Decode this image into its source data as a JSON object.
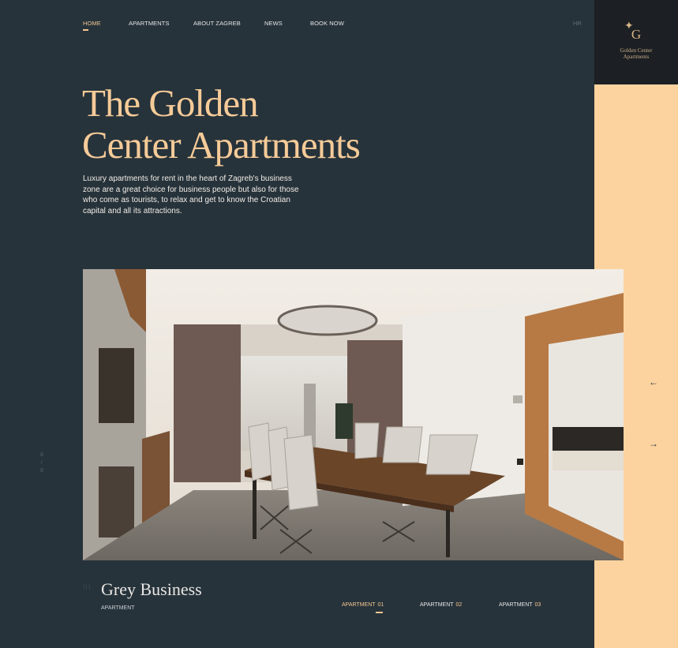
{
  "nav": {
    "items": [
      {
        "label": "HOME"
      },
      {
        "label": "APARTMENTS"
      },
      {
        "label": "ABOUT ZAGREB"
      },
      {
        "label": "NEWS"
      },
      {
        "label": "BOOK NOW"
      }
    ],
    "active_index": 0,
    "language": "HR"
  },
  "logo": {
    "letter": "G",
    "name_line1": "Golden Center",
    "name_line2": "Apartments"
  },
  "hero": {
    "title_line1": "The Golden",
    "title_line2": "Center Apartments",
    "description": "Luxury apartments for rent in the heart of Zagreb's business zone are a great choice for business people but also for those who come as tourists, to relax and get to know the Croatian capital and all its attractions."
  },
  "slider": {
    "current": "8",
    "separator": "/",
    "total": "8",
    "prev_icon": "arrow-left-icon",
    "next_icon": "arrow-right-icon"
  },
  "apartment": {
    "number": "01",
    "name": "Grey Business",
    "subtitle": "APARTMENT"
  },
  "apartment_tabs": [
    {
      "label": "APARTMENT",
      "num": "01"
    },
    {
      "label": "APARTMENT",
      "num": "02"
    },
    {
      "label": "APARTMENT",
      "num": "03"
    }
  ],
  "colors": {
    "background": "#27333b",
    "accent": "#f6cb98",
    "side_panel": "#fcd39f",
    "logo_box": "#1c1f23"
  }
}
